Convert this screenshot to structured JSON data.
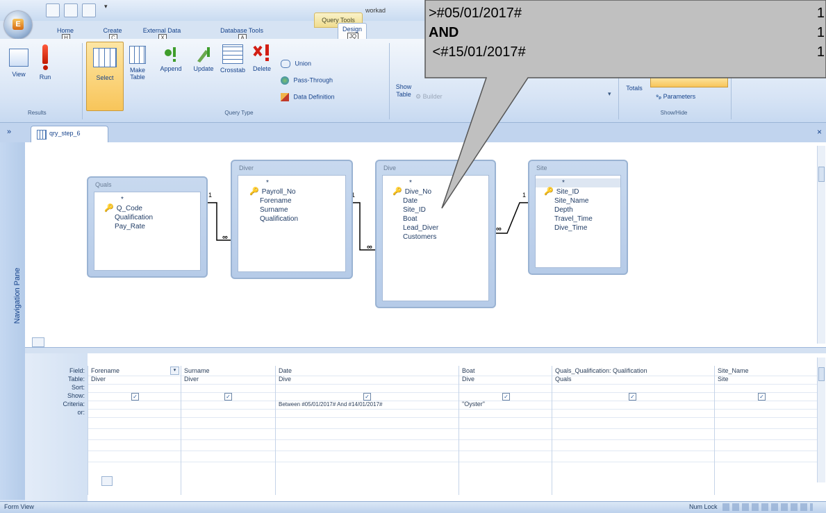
{
  "window": {
    "title": "workad",
    "contextual_tab": "Query Tools"
  },
  "tabs": [
    {
      "label": "Home",
      "keytip": "H"
    },
    {
      "label": "Create",
      "keytip": "C"
    },
    {
      "label": "External Data",
      "keytip": "X"
    },
    {
      "label": "Database Tools",
      "keytip": "A"
    },
    {
      "label": "Design",
      "keytip": "JQ"
    }
  ],
  "ribbon": {
    "results": {
      "label": "Results",
      "view": "View",
      "run": "Run"
    },
    "query_type": {
      "label": "Query Type",
      "select": "Select",
      "make_table": "Make Table",
      "append": "Append",
      "update": "Update",
      "crosstab": "Crosstab",
      "delete": "Delete",
      "union": "Union",
      "pass_through": "Pass-Through",
      "data_definition": "Data Definition"
    },
    "setup": {
      "show_table": "Show Table",
      "builder": "Builder"
    },
    "show_hide": {
      "label": "Show/Hide",
      "totals": "Totals",
      "parameters": "Parameters"
    }
  },
  "tooltip": {
    "lines": [
      {
        "text": ">#05/01/2017#",
        "count": "1",
        "bold": false
      },
      {
        "text": "AND",
        "count": "1",
        "bold": true
      },
      {
        "text": " <#15/01/2017#",
        "count": "1",
        "bold": false
      }
    ]
  },
  "document": {
    "tab_name": "qry_step_6",
    "close": "×"
  },
  "navigation_pane": "Navigation Pane",
  "tables": [
    {
      "name": "Quals",
      "fields": [
        "*",
        "Q_Code",
        "Qualification",
        "Pay_Rate"
      ],
      "key_index": 1
    },
    {
      "name": "Diver",
      "fields": [
        "*",
        "Payroll_No",
        "Forename",
        "Surname",
        "Qualification"
      ],
      "key_index": 1
    },
    {
      "name": "Dive",
      "fields": [
        "*",
        "Dive_No",
        "Date",
        "Site_ID",
        "Boat",
        "Lead_Diver",
        "Customers"
      ],
      "key_index": 1
    },
    {
      "name": "Site",
      "fields": [
        "*",
        "Site_ID",
        "Site_Name",
        "Depth",
        "Travel_Time",
        "Dive_Time"
      ],
      "key_index": 1
    }
  ],
  "relationship_labels": {
    "one": "1",
    "many": "∞"
  },
  "grid": {
    "row_labels": [
      "Field:",
      "Table:",
      "Sort:",
      "Show:",
      "Criteria:",
      "or:"
    ],
    "columns": [
      {
        "field": "Forename",
        "table": "Diver",
        "show": true,
        "criteria": ""
      },
      {
        "field": "Surname",
        "table": "Diver",
        "show": true,
        "criteria": ""
      },
      {
        "field": "Date",
        "table": "Dive",
        "show": true,
        "criteria": "Between #05/01/2017# And #14/01/2017#"
      },
      {
        "field": "Boat",
        "table": "Dive",
        "show": true,
        "criteria": "\"Oyster\""
      },
      {
        "field": "Quals_Qualification: Qualification",
        "table": "Quals",
        "show": true,
        "criteria": ""
      },
      {
        "field": "Site_Name",
        "table": "Site",
        "show": true,
        "criteria": ""
      }
    ]
  },
  "status": {
    "left": "Form View",
    "right": "Num Lock"
  }
}
